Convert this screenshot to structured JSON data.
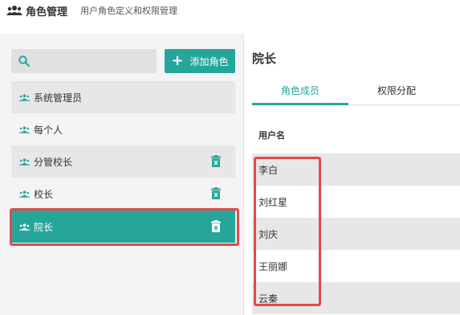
{
  "header": {
    "title": "角色管理",
    "subtitle": "用户角色定义和权限管理"
  },
  "search": {
    "placeholder": ""
  },
  "add_button": {
    "label": "添加角色"
  },
  "roles": [
    {
      "label": "系统管理员",
      "deletable": false
    },
    {
      "label": "每个人",
      "deletable": false
    },
    {
      "label": "分管校长",
      "deletable": true
    },
    {
      "label": "校长",
      "deletable": true
    },
    {
      "label": "院长",
      "deletable": true,
      "selected": true
    }
  ],
  "panel": {
    "title": "院长",
    "tabs": [
      {
        "label": "角色成员",
        "active": true
      },
      {
        "label": "权限分配",
        "active": false
      }
    ],
    "column_header": "用户名",
    "users": [
      "李白",
      "刘红星",
      "刘庆",
      "王丽娜",
      "云秦"
    ]
  },
  "colors": {
    "accent": "#26a69a",
    "highlight": "#e04a4a"
  }
}
